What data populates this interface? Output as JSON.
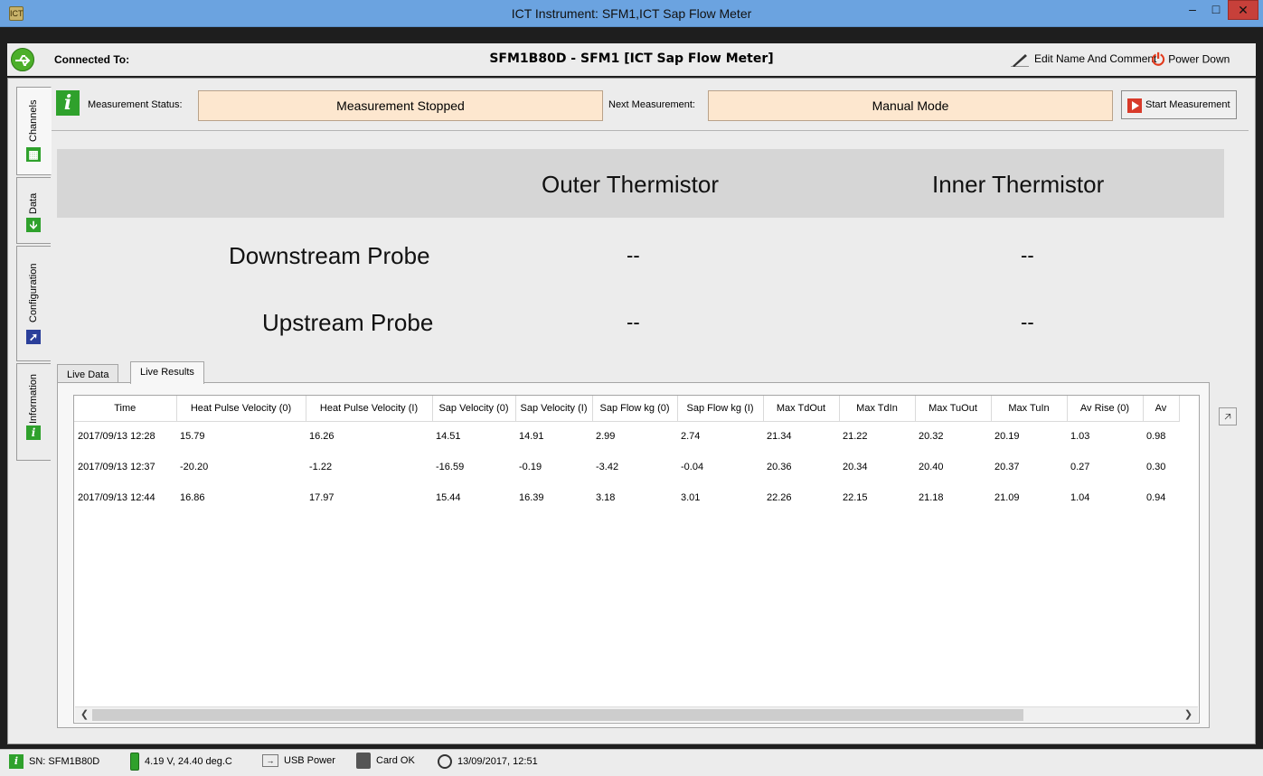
{
  "window": {
    "title": "ICT Instrument: SFM1,ICT Sap Flow Meter"
  },
  "connection": {
    "label": "Connected To:",
    "device": "SFM1B80D - SFM1 [ICT Sap Flow Meter]",
    "edit_label": "Edit Name And Comment",
    "power_label": "Power Down"
  },
  "side_tabs": [
    "Channels",
    "Data",
    "Configuration",
    "Information"
  ],
  "measurement": {
    "status_label": "Measurement Status:",
    "status_value": "Measurement Stopped",
    "next_label": "Next Measurement:",
    "next_value": "Manual Mode",
    "start_label": "Start Measurement"
  },
  "thermistors": {
    "outer_header": "Outer Thermistor",
    "inner_header": "Inner Thermistor",
    "rows": [
      {
        "label": "Downstream Probe",
        "outer": "--",
        "inner": "--"
      },
      {
        "label": "Upstream Probe",
        "outer": "--",
        "inner": "--"
      }
    ]
  },
  "sub_tabs": [
    "Live Data",
    "Live Results"
  ],
  "results_table": {
    "columns": [
      "Time",
      "Heat Pulse Velocity (0)",
      "Heat Pulse Velocity (I)",
      "Sap Velocity (0)",
      "Sap Velocity (I)",
      "Sap Flow kg (0)",
      "Sap Flow kg (I)",
      "Max TdOut",
      "Max TdIn",
      "Max TuOut",
      "Max TuIn",
      "Av Rise (0)",
      "Av"
    ],
    "rows": [
      [
        "2017/09/13 12:28",
        "15.79",
        "16.26",
        "14.51",
        "14.91",
        "2.99",
        "2.74",
        "21.34",
        "21.22",
        "20.32",
        "20.19",
        "1.03",
        "0.98"
      ],
      [
        "2017/09/13 12:37",
        "-20.20",
        "-1.22",
        "-16.59",
        "-0.19",
        "-3.42",
        "-0.04",
        "20.36",
        "20.34",
        "20.40",
        "20.37",
        "0.27",
        "0.30"
      ],
      [
        "2017/09/13 12:44",
        "16.86",
        "17.97",
        "15.44",
        "16.39",
        "3.18",
        "3.01",
        "22.26",
        "22.15",
        "21.18",
        "21.09",
        "1.04",
        "0.94"
      ]
    ]
  },
  "status_bar": {
    "serial": "SN: SFM1B80D",
    "battery": "4.19 V, 24.40 deg.C",
    "power": "USB Power",
    "card": "Card OK",
    "datetime": "13/09/2017, 12:51"
  },
  "colors": {
    "titlebar": "#6ba3e0",
    "accent_green": "#2fa12c",
    "status_box": "#fde7cf",
    "close_button": "#c7403a",
    "power_icon": "#e23a1c"
  }
}
